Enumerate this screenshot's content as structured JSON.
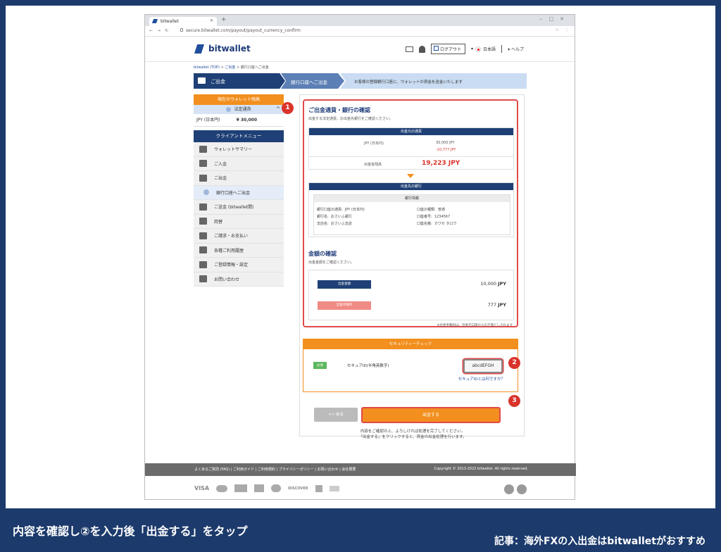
{
  "browser": {
    "tab_title": "bitwallet",
    "url": "secure.bitwallet.com/payout/payout_currency_confirm"
  },
  "header": {
    "logo": "bitwallet",
    "logout": "ログアウト",
    "language": "日本語",
    "help": "ヘルプ"
  },
  "breadcrumb": {
    "home": "bitwallet (TOP)",
    "sep": ">",
    "payout": "ご出金",
    "current": "銀行口座へご出金"
  },
  "steps": {
    "s1": "ご出金",
    "s2": "銀行口座へご出金",
    "s3": "お客様の登録銀行口座に、ウォレットの資金を送金いたします"
  },
  "sidebar": {
    "wallet_header": "現在のウォレット残高",
    "wallet_sub": "法定通貨",
    "balance_currency": "JPY (日本円)",
    "balance_amount": "¥ 30,000",
    "menu_header": "クライアントメニュー",
    "items": [
      {
        "label": "ウォレットサマリー"
      },
      {
        "label": "ご入金"
      },
      {
        "label": "ご出金"
      },
      {
        "label": "銀行口座へご出金"
      },
      {
        "label": "ご送金 (bitwallet間)"
      },
      {
        "label": "両替"
      },
      {
        "label": "ご請求・お支払い"
      },
      {
        "label": "各種ご利用履歴"
      },
      {
        "label": "ご登録情報・設定"
      },
      {
        "label": "お問い合わせ"
      }
    ]
  },
  "confirm": {
    "title": "ご出金通貨・銀行の確認",
    "desc": "出金する法定通貨、お出金先銀行をご確認ください。",
    "currency_bar": "出金元の通貨",
    "currency": "JPY (日本円)",
    "amount": "30,000 JPY",
    "fee": "-10,777 JPY",
    "after_label": "出金後残高",
    "after_value": "19,223 JPY",
    "bank_bar": "出金先の銀行",
    "bank_info_hdr": "銀行情報",
    "bank_rows": [
      {
        "k1": "銀行口座の通貨:",
        "v1": "JPY (日本円)",
        "k2": "口座の種類:",
        "v2": "普通"
      },
      {
        "k1": "銀行名:",
        "v1": "おさいふ銀行",
        "k2": "口座番号:",
        "v2": "1234567"
      },
      {
        "k1": "支店名:",
        "v1": "おさいふ支店",
        "k2": "口座名義:",
        "v2": "カワセ タロウ"
      }
    ],
    "amount_title": "金額の確認",
    "amount_desc": "出金金額をご確認ください。",
    "out_label": "出金金額",
    "out_value": "10,000",
    "fee_label": "出金手数料",
    "fee_value": "777",
    "unit": "JPY",
    "fee_note": "※出金手数料は、出金元口座から引き落としされます"
  },
  "security": {
    "header": "セキュリティーチェック",
    "required": "必須",
    "label": "セキュアID(半角英数字)",
    "value": "abcdEFGH",
    "help": "セキュアIDとは何ですか？"
  },
  "buttons": {
    "back": "<< 戻る",
    "submit": "出金する"
  },
  "note": {
    "l1": "内容をご確認の上、よろしければ処理を完了してください。",
    "l2": "「出金する」をクリックすると、資金の出金処理を行います。"
  },
  "footer": {
    "links": "よくあるご質問 (FAQ)  |  ご利用ガイド  |  ご利用規約  |  プライバシーポリシー  |  お問い合わせ  |  会社概要",
    "copyright": "Copyright © 2013-2022 bitwallet. All rights reserved."
  },
  "payments": {
    "visa": "VISA",
    "discover": "DISCOVER"
  },
  "badges": {
    "b1": "1",
    "b2": "2",
    "b3": "3"
  },
  "caption": "内容を確認し②を入力後「出金する」をタップ",
  "article": "記事：海外FXの入出金はbitwalletがおすすめ"
}
